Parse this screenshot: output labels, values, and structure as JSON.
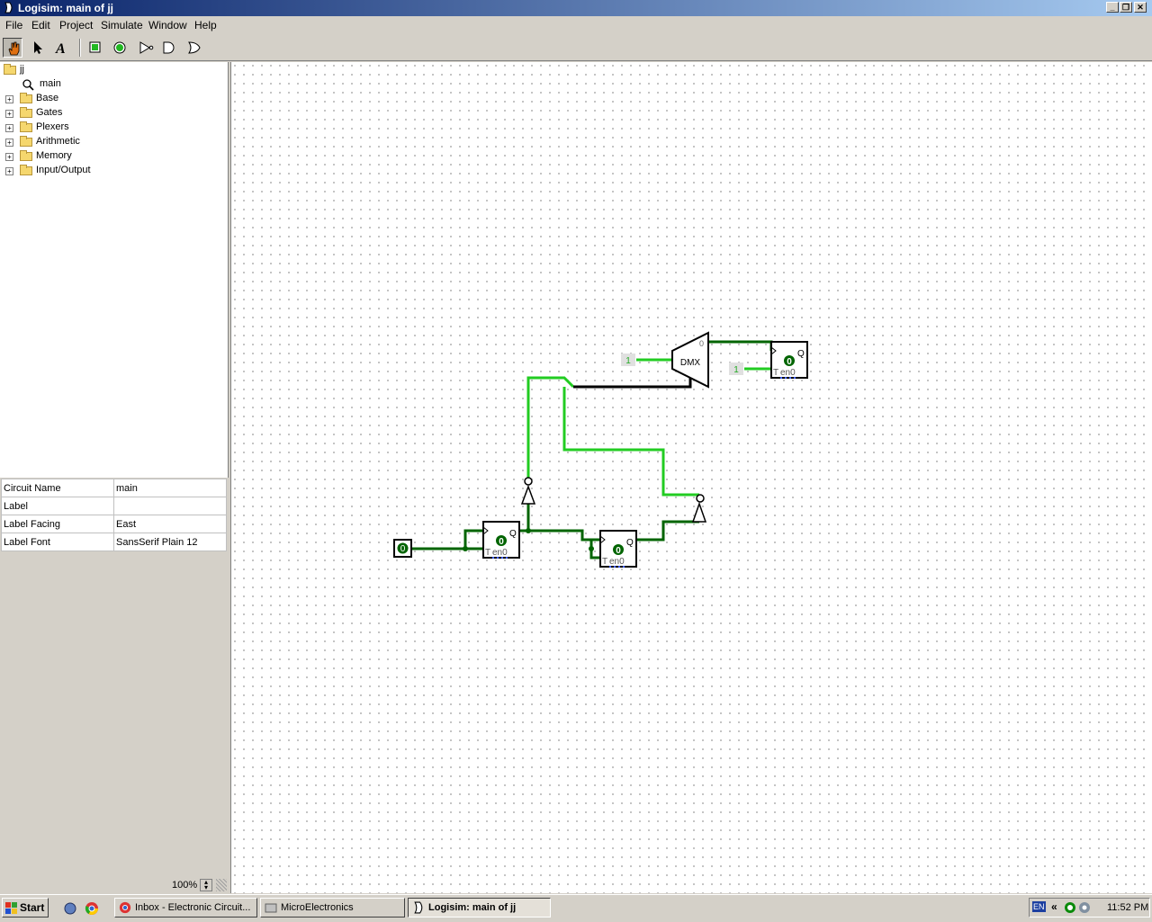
{
  "window": {
    "title": "Logisim: main of jj"
  },
  "menu": [
    "File",
    "Edit",
    "Project",
    "Simulate",
    "Window",
    "Help"
  ],
  "toolbar": {
    "tools": [
      "poke-tool",
      "select-tool",
      "text-tool",
      "input-pin",
      "output-pin",
      "not-gate",
      "and-gate",
      "or-gate"
    ],
    "selected": "poke-tool"
  },
  "explorer": {
    "project": "jj",
    "circuit": "main",
    "libraries": [
      "Base",
      "Gates",
      "Plexers",
      "Arithmetic",
      "Memory",
      "Input/Output"
    ]
  },
  "attributes": [
    {
      "name": "Circuit Name",
      "value": "main"
    },
    {
      "name": "Label",
      "value": ""
    },
    {
      "name": "Label Facing",
      "value": "East"
    },
    {
      "name": "Label Font",
      "value": "SansSerif Plain 12"
    }
  ],
  "zoom": "100%",
  "circuit": {
    "input_pin_value": "0",
    "ff1": {
      "q_label": "Q",
      "state": "0",
      "bottom": "T",
      "en": "en0"
    },
    "ff2": {
      "q_label": "Q",
      "state": "0",
      "bottom": "T",
      "en": "en0"
    },
    "ff3": {
      "q_label": "Q",
      "state": "0",
      "bottom": "T",
      "en": "en0"
    },
    "const1": "1",
    "const2": "1",
    "demux_label": "DMX",
    "demux_sel": "0",
    "wire_colors": {
      "high": "#22cc22",
      "low": "#006400",
      "bus": "#000000"
    }
  },
  "taskbar": {
    "start": "Start",
    "tasks": [
      "Inbox - Electronic Circuit...",
      "MicroElectronics",
      "Logisim: main of jj"
    ],
    "active_task": "Logisim: main of jj",
    "lang": "EN",
    "clock": "11:52 PM"
  }
}
